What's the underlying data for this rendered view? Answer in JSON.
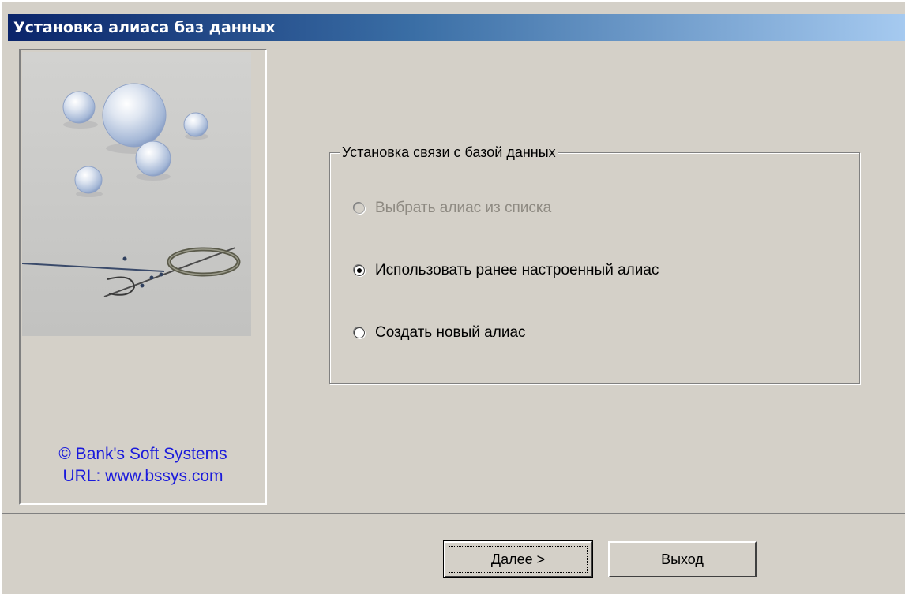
{
  "window": {
    "title": "Установка алиаса баз данных"
  },
  "side_panel": {
    "copyright_line1": "© Bank's Soft Systems",
    "copyright_line2": "URL:  www.bssys.com"
  },
  "group": {
    "legend": "Установка связи с базой данных",
    "options": [
      {
        "label": "Выбрать алиас из списка",
        "checked": false,
        "enabled": false
      },
      {
        "label": "Использовать ранее настроенный алиас",
        "checked": true,
        "enabled": true
      },
      {
        "label": "Создать новый алиас",
        "checked": false,
        "enabled": true
      }
    ]
  },
  "buttons": {
    "next_label": "Далее >",
    "exit_label": "Выход"
  },
  "colors": {
    "face": "#d4d0c8",
    "title_start": "#0a246a",
    "title_end": "#a6caf0",
    "copyright_text": "#1a1adc",
    "disabled_text": "#8e8a82"
  }
}
